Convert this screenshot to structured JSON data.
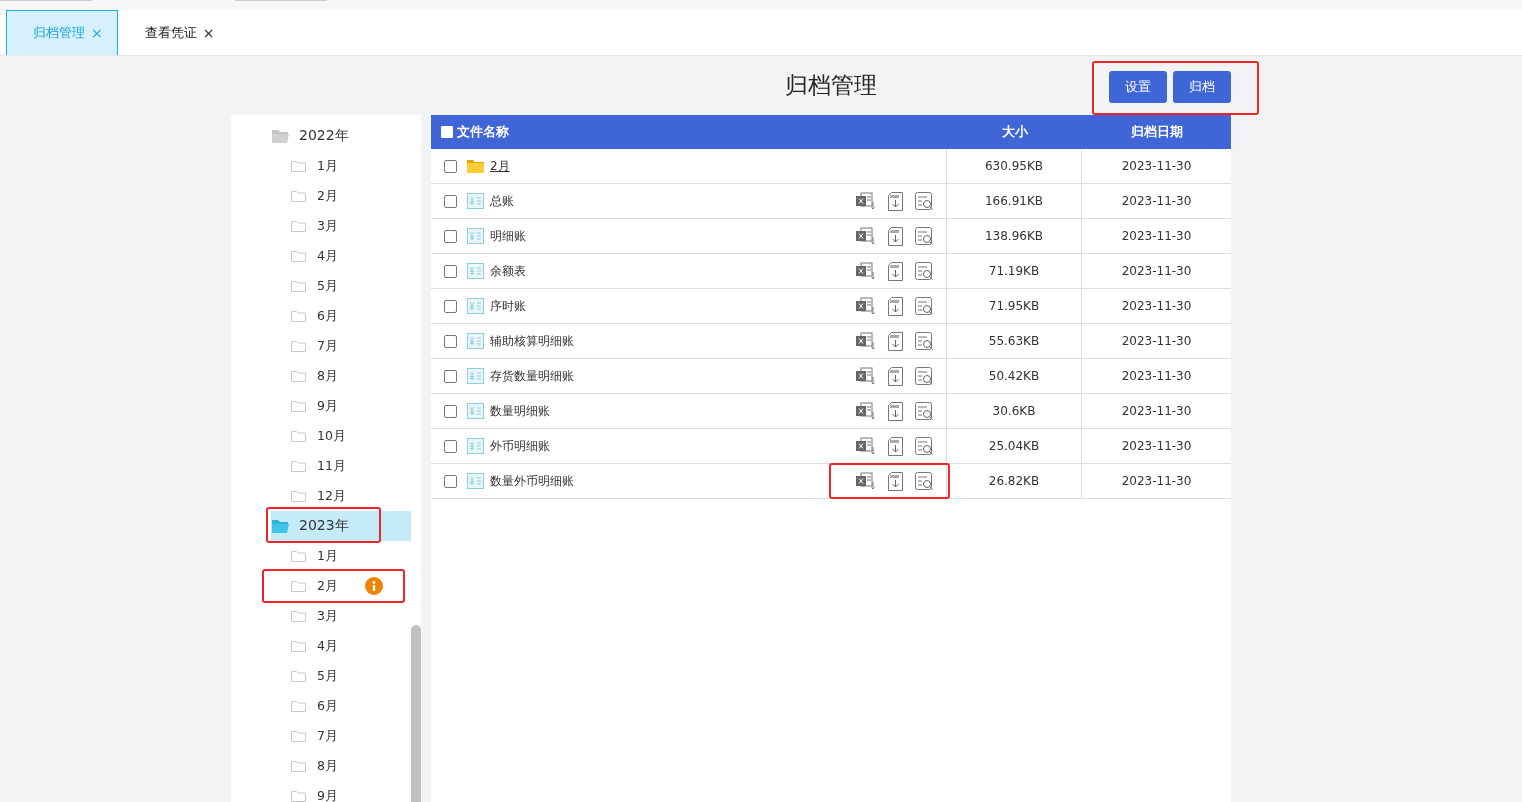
{
  "tabs": [
    {
      "label": "归档管理",
      "close": "×",
      "selected": true
    },
    {
      "label": "查看凭证",
      "close": "×",
      "selected": false
    }
  ],
  "page_title": "归档管理",
  "toolbar": {
    "highlighted": true,
    "buttons": [
      "设置",
      "归档"
    ]
  },
  "tree": [
    {
      "label": "2022年",
      "selected": false,
      "highlighted": false,
      "children": [
        {
          "label": "1月",
          "highlighted": false,
          "warning": false
        },
        {
          "label": "2月",
          "highlighted": false,
          "warning": false
        },
        {
          "label": "3月",
          "highlighted": false,
          "warning": false
        },
        {
          "label": "4月",
          "highlighted": false,
          "warning": false
        },
        {
          "label": "5月",
          "highlighted": false,
          "warning": false
        },
        {
          "label": "6月",
          "highlighted": false,
          "warning": false
        },
        {
          "label": "7月",
          "highlighted": false,
          "warning": false
        },
        {
          "label": "8月",
          "highlighted": false,
          "warning": false
        },
        {
          "label": "9月",
          "highlighted": false,
          "warning": false
        },
        {
          "label": "10月",
          "highlighted": false,
          "warning": false
        },
        {
          "label": "11月",
          "highlighted": false,
          "warning": false
        },
        {
          "label": "12月",
          "highlighted": false,
          "warning": false
        }
      ]
    },
    {
      "label": "2023年",
      "selected": true,
      "highlighted": true,
      "children": [
        {
          "label": "1月",
          "highlighted": false,
          "warning": false
        },
        {
          "label": "2月",
          "highlighted": true,
          "warning": true
        },
        {
          "label": "3月",
          "highlighted": false,
          "warning": false
        },
        {
          "label": "4月",
          "highlighted": false,
          "warning": false
        },
        {
          "label": "5月",
          "highlighted": false,
          "warning": false
        },
        {
          "label": "6月",
          "highlighted": false,
          "warning": false
        },
        {
          "label": "7月",
          "highlighted": false,
          "warning": false
        },
        {
          "label": "8月",
          "highlighted": false,
          "warning": false
        },
        {
          "label": "9月",
          "highlighted": false,
          "warning": false
        }
      ]
    }
  ],
  "table": {
    "columns": [
      "文件名称",
      "大小",
      "归档日期"
    ],
    "all_checked": false,
    "rows": [
      {
        "kind": "folder",
        "name": "2月",
        "size": "630.95KB",
        "date": "2023-11-30",
        "checked": false
      },
      {
        "kind": "file",
        "name": "总账",
        "size": "166.91KB",
        "date": "2023-11-30",
        "checked": false,
        "highlighted": false
      },
      {
        "kind": "file",
        "name": "明细账",
        "size": "138.96KB",
        "date": "2023-11-30",
        "checked": false,
        "highlighted": false
      },
      {
        "kind": "file",
        "name": "余额表",
        "size": "71.19KB",
        "date": "2023-11-30",
        "checked": false,
        "highlighted": false
      },
      {
        "kind": "file",
        "name": "序时账",
        "size": "71.95KB",
        "date": "2023-11-30",
        "checked": false,
        "highlighted": false
      },
      {
        "kind": "file",
        "name": "辅助核算明细账",
        "size": "55.63KB",
        "date": "2023-11-30",
        "checked": false,
        "highlighted": false
      },
      {
        "kind": "file",
        "name": "存货数量明细账",
        "size": "50.42KB",
        "date": "2023-11-30",
        "checked": false,
        "highlighted": false
      },
      {
        "kind": "file",
        "name": "数量明细账",
        "size": "30.6KB",
        "date": "2023-11-30",
        "checked": false,
        "highlighted": false
      },
      {
        "kind": "file",
        "name": "外币明细账",
        "size": "25.04KB",
        "date": "2023-11-30",
        "checked": false,
        "highlighted": false
      },
      {
        "kind": "file",
        "name": "数量外币明细账",
        "size": "26.82KB",
        "date": "2023-11-30",
        "checked": false,
        "highlighted": true
      }
    ]
  }
}
